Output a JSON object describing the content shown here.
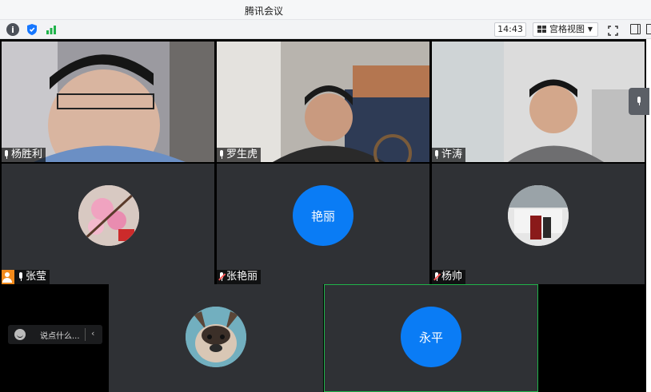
{
  "window": {
    "title": "腾讯会议"
  },
  "toolbar": {
    "info_icon": "info-icon",
    "shield_icon": "shield-icon",
    "signal_icon": "signal-icon",
    "time": "14:43",
    "view_mode": "宫格视图",
    "accent": "#0a7cf5"
  },
  "participants": [
    {
      "name": "杨胜利",
      "video": true,
      "mic": "on"
    },
    {
      "name": "罗生虎",
      "video": true,
      "mic": "on"
    },
    {
      "name": "许涛",
      "video": true,
      "mic": "on"
    },
    {
      "name": "张莹",
      "video": false,
      "mic": "on",
      "host": true,
      "avatar": "plum-blossom-photo"
    },
    {
      "name": "张艳丽",
      "video": false,
      "mic": "muted",
      "avatar_text": "艳丽"
    },
    {
      "name": "杨帅",
      "video": false,
      "mic": "muted",
      "avatar": "room-photo"
    },
    {
      "name": "",
      "video": false,
      "avatar": "dog-photo"
    },
    {
      "name": "",
      "video": false,
      "avatar_text": "永平"
    }
  ],
  "chat": {
    "placeholder": "说点什么..."
  }
}
